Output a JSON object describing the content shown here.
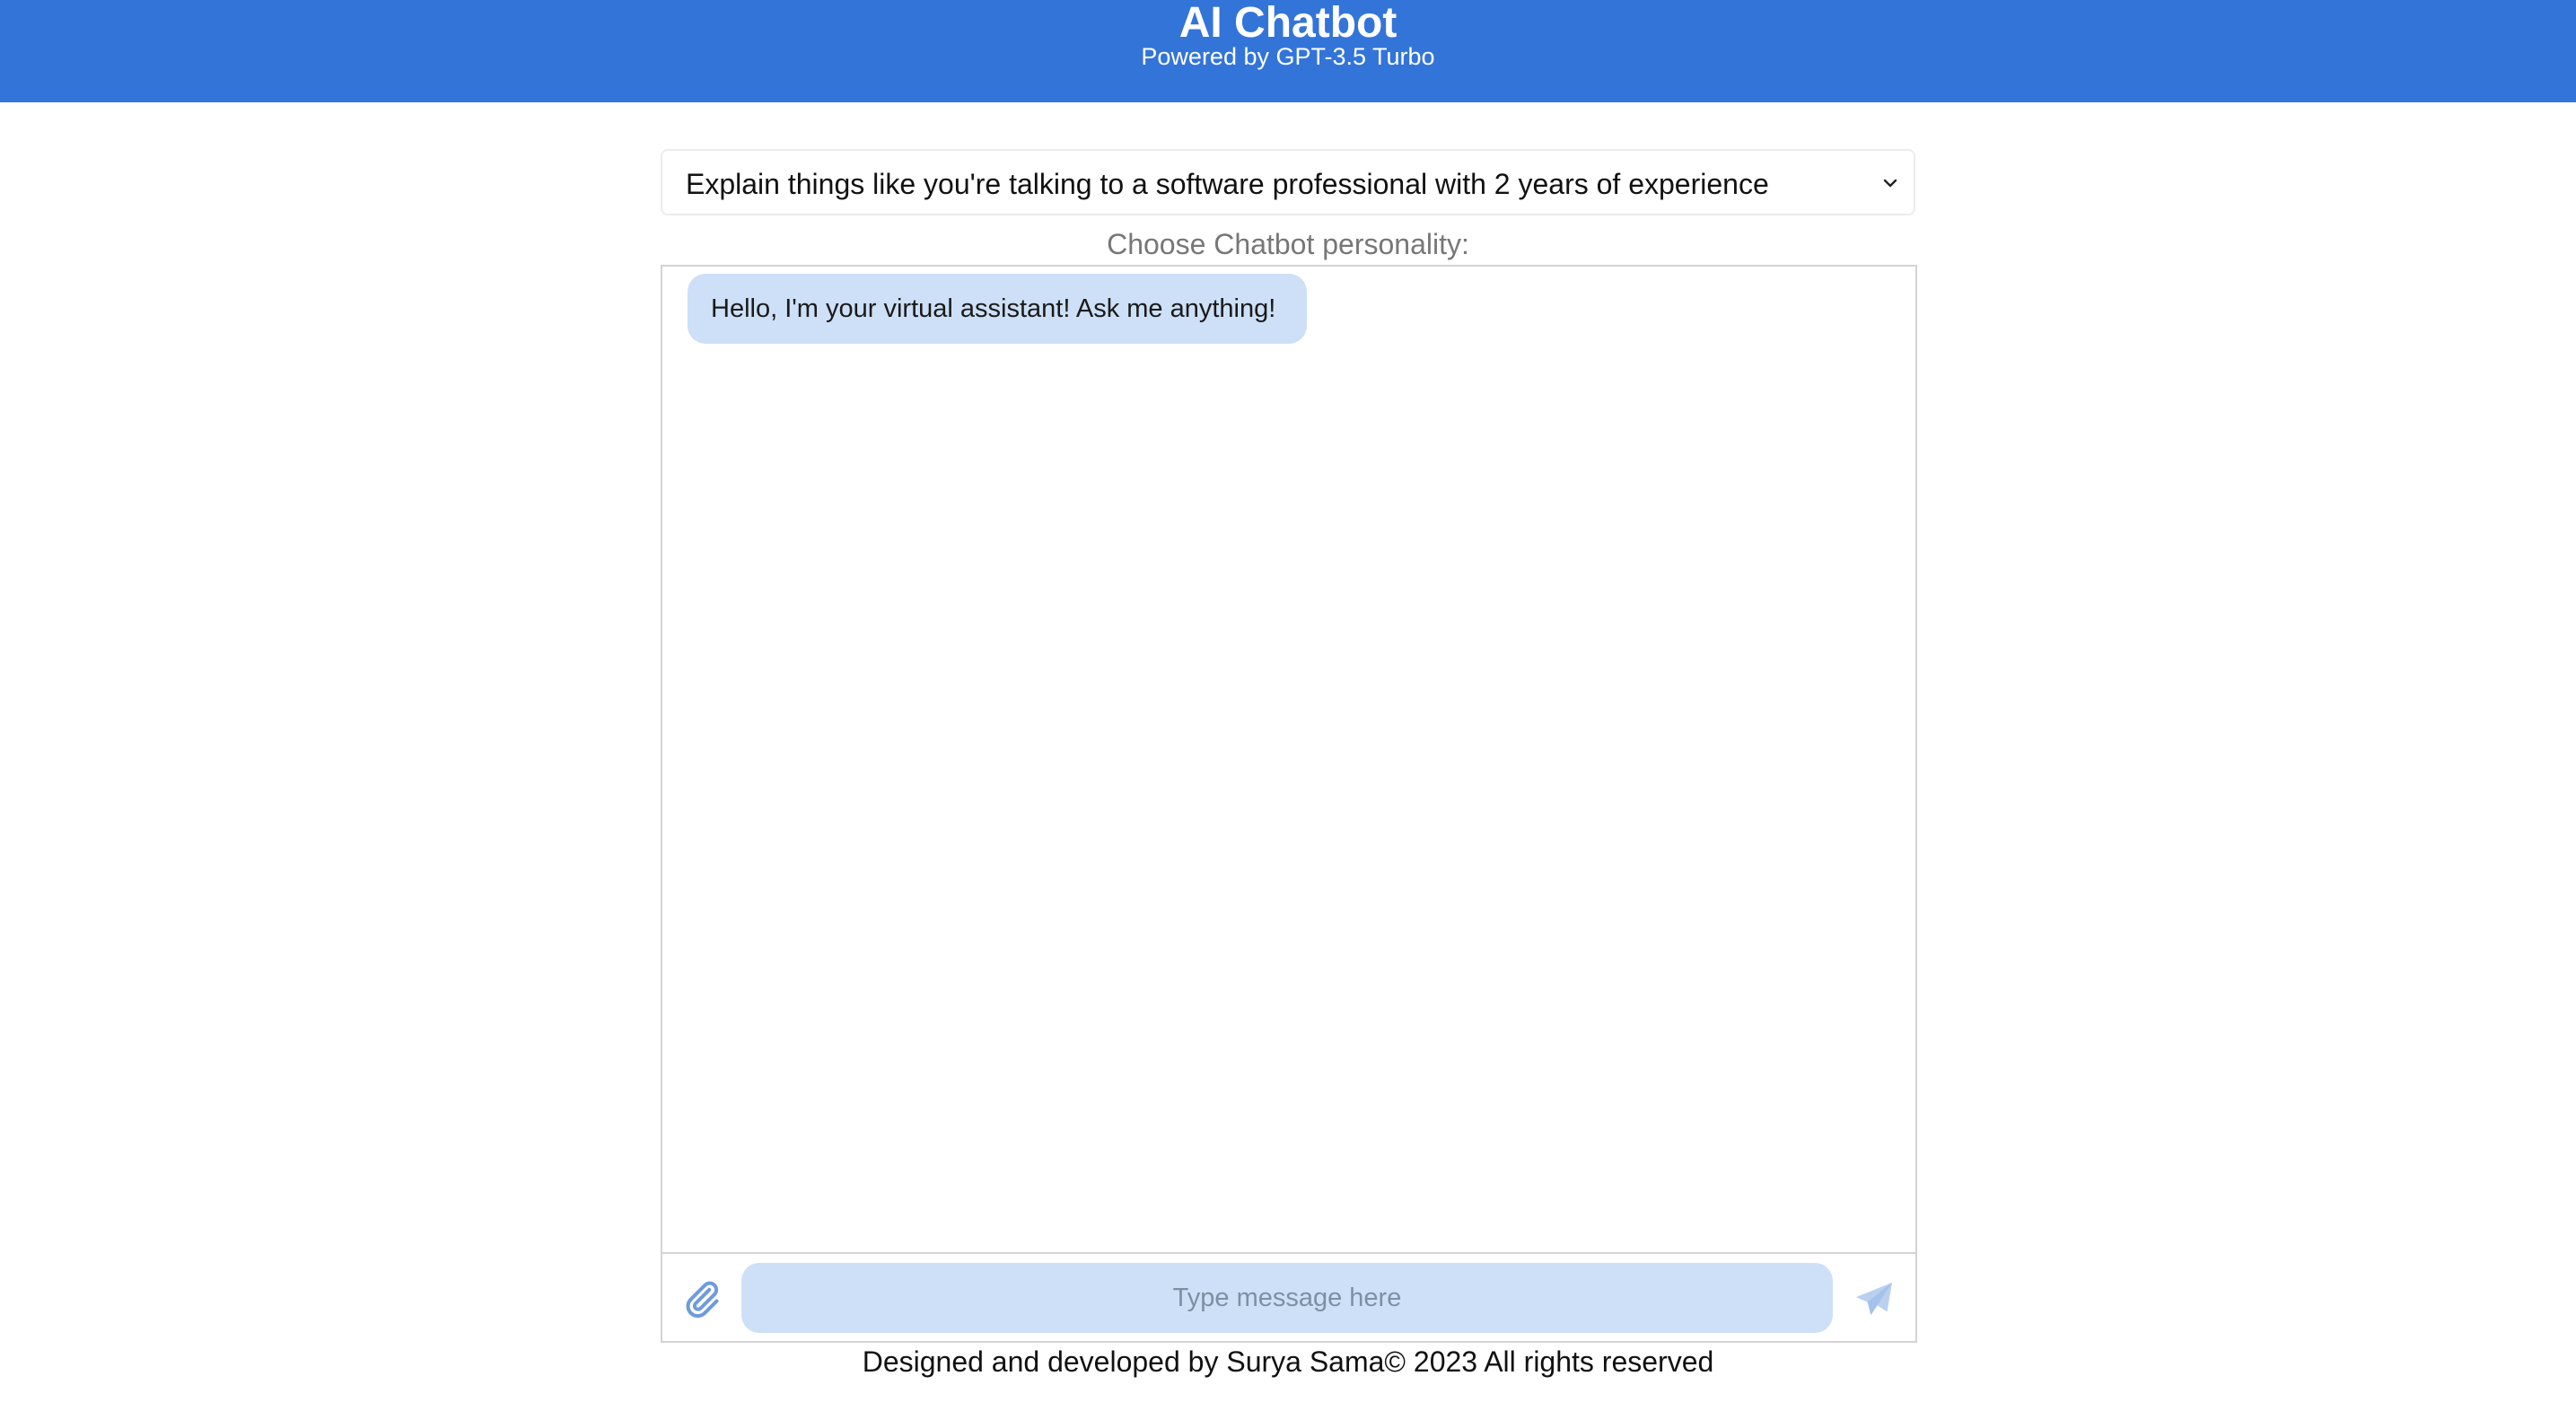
{
  "header": {
    "title": "AI Chatbot",
    "subtitle": "Powered by GPT-3.5 Turbo"
  },
  "personality": {
    "selected": "Explain things like you're talking to a software professional with 2 years of experience",
    "label": "Choose Chatbot personality:",
    "chevron_icon": "chevron-down-icon"
  },
  "chat": {
    "messages": [
      {
        "sender": "bot",
        "text": "Hello, I'm your virtual assistant! Ask me anything!"
      }
    ]
  },
  "composer": {
    "placeholder": "Type message here",
    "value": "",
    "attach_icon": "paperclip-icon",
    "send_icon": "send-icon"
  },
  "footer": {
    "text": "Designed and developed by Surya Sama© 2023 All rights reserved"
  },
  "colors": {
    "header_bg": "#3374d9",
    "bubble_bg": "#cde0f7",
    "icon_color": "#7aa5e3"
  }
}
